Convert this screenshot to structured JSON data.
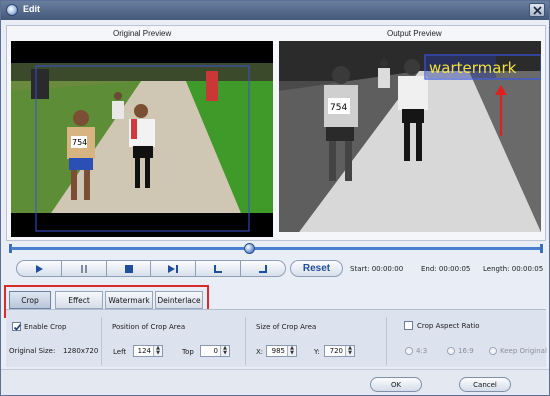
{
  "window": {
    "title": "Edit"
  },
  "preview": {
    "original_label": "Original Preview",
    "output_label": "Output Preview",
    "watermark_text": "wartermark",
    "bib_number": "754"
  },
  "timeline": {
    "position_fraction": 0.45
  },
  "transport": {
    "buttons": [
      "play-icon",
      "pause-icon",
      "stop-icon",
      "next-frame-icon",
      "mark-start-icon",
      "mark-end-icon"
    ],
    "reset_label": "Reset"
  },
  "times": {
    "start_label": "Start:",
    "start_value": "00:00:00",
    "end_label": "End:",
    "end_value": "00:00:05",
    "length_label": "Length:",
    "length_value": "00:00:05"
  },
  "tabs": [
    {
      "label": "Crop",
      "active": true
    },
    {
      "label": "Effect",
      "active": false
    },
    {
      "label": "Watermark",
      "active": false
    },
    {
      "label": "Deinterlace",
      "active": false
    }
  ],
  "crop": {
    "enable_label": "Enable Crop",
    "enable_checked": true,
    "original_size_label": "Original Size:",
    "original_size_value": "1280x720",
    "position_title": "Position of Crop Area",
    "left_label": "Left",
    "left_value": "124",
    "top_label": "Top",
    "top_value": "0",
    "size_title": "Size of Crop Area",
    "x_label": "X:",
    "x_value": "985",
    "y_label": "Y:",
    "y_value": "720",
    "aspect_label": "Crop Aspect Ratio",
    "aspect_checked": false,
    "aspect_options": [
      "4:3",
      "16:9",
      "Keep Original"
    ]
  },
  "dialog": {
    "ok_label": "OK",
    "cancel_label": "Cancel"
  },
  "colors": {
    "accent": "#4a7fd0",
    "highlight": "#d92b2b",
    "watermark": "#f2e13a"
  }
}
